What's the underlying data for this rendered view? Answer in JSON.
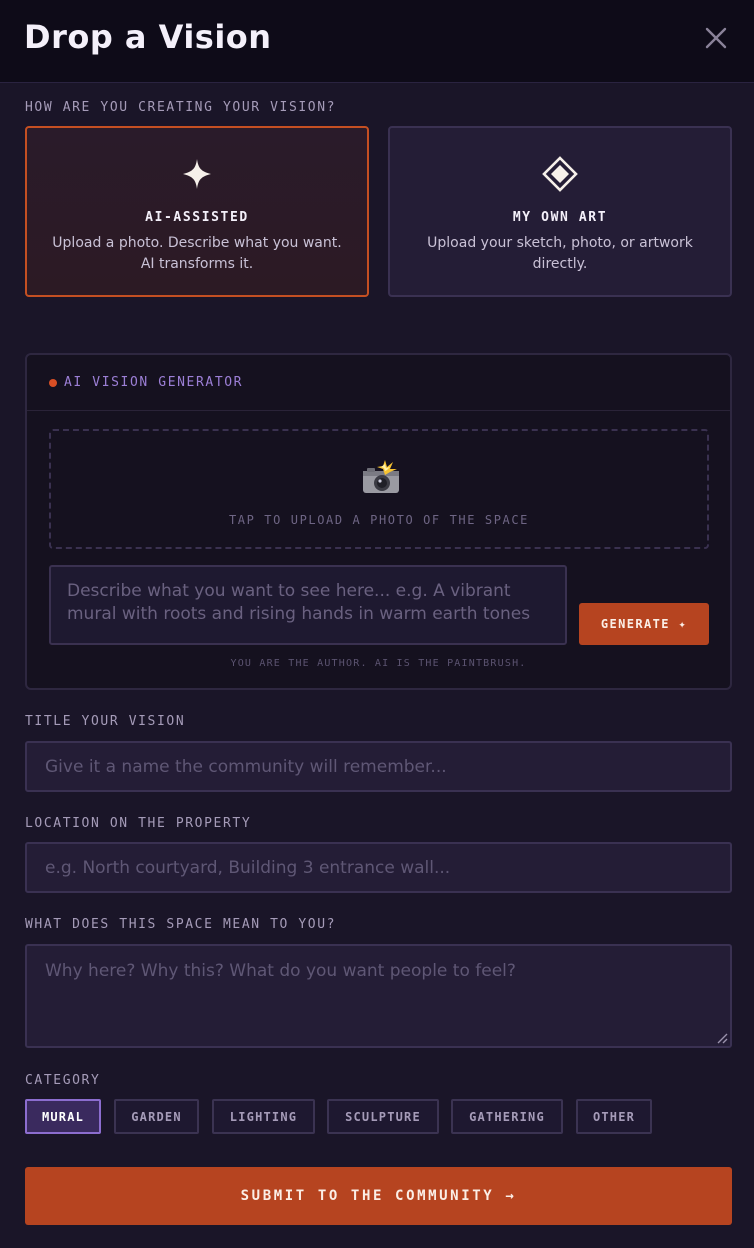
{
  "header": {
    "title": "Drop a Vision",
    "close_icon": "close-icon"
  },
  "creation_mode": {
    "label": "HOW ARE YOU CREATING YOUR VISION?",
    "options": [
      {
        "icon": "sparkle-icon",
        "title": "AI-ASSISTED",
        "description": "Upload a photo. Describe what you want. AI transforms it.",
        "selected": true
      },
      {
        "icon": "diamond-icon",
        "title": "MY OWN ART",
        "description": "Upload your sketch, photo, or artwork directly.",
        "selected": false
      }
    ]
  },
  "generator": {
    "label": "AI VISION GENERATOR",
    "status_color": "#d94f25",
    "upload": {
      "icon": "camera-flash-icon",
      "text": "TAP TO UPLOAD A PHOTO OF THE SPACE"
    },
    "prompt": {
      "placeholder": "Describe what you want to see here... e.g. A vibrant mural with roots and rising hands in warm earth tones",
      "value": ""
    },
    "generate_label": "GENERATE ✦",
    "note": "YOU ARE THE AUTHOR. AI IS THE PAINTBRUSH."
  },
  "form": {
    "title": {
      "label": "TITLE YOUR VISION",
      "placeholder": "Give it a name the community will remember...",
      "value": ""
    },
    "location": {
      "label": "LOCATION ON THE PROPERTY",
      "placeholder": "e.g. North courtyard, Building 3 entrance wall...",
      "value": ""
    },
    "meaning": {
      "label": "WHAT DOES THIS SPACE MEAN TO YOU?",
      "placeholder": "Why here? Why this? What do you want people to feel?",
      "value": ""
    },
    "category": {
      "label": "CATEGORY",
      "options": [
        "MURAL",
        "GARDEN",
        "LIGHTING",
        "SCULPTURE",
        "GATHERING",
        "OTHER"
      ],
      "selected": "MURAL"
    }
  },
  "submit_label": "SUBMIT TO THE COMMUNITY →",
  "colors": {
    "accent": "#b64420",
    "accent_border": "#c44f22",
    "selected_chip": "#3a2a5e",
    "background": "#1a1528"
  }
}
